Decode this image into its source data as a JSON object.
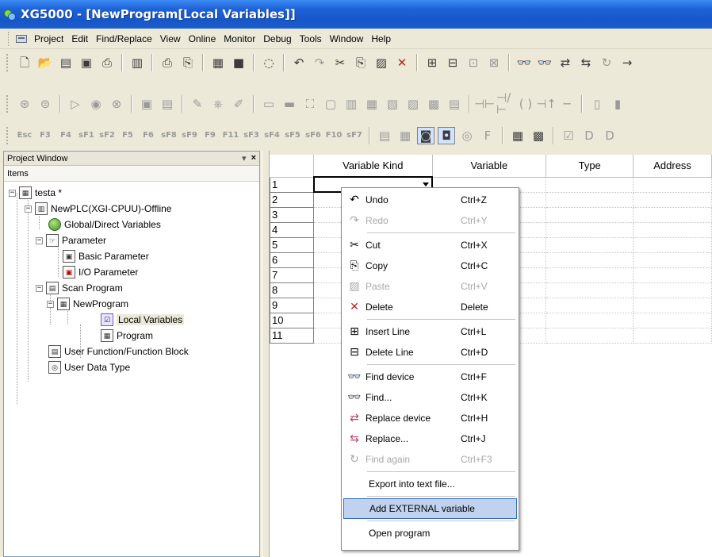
{
  "window": {
    "title": "XG5000 - [NewProgram[Local Variables]]"
  },
  "menubar": {
    "items": [
      "Project",
      "Edit",
      "Find/Replace",
      "View",
      "Online",
      "Monitor",
      "Debug",
      "Tools",
      "Window",
      "Help"
    ]
  },
  "project_window": {
    "title": "Project Window",
    "header": "Items",
    "pin": "▾",
    "close": "×",
    "tree": [
      {
        "label": "testa *",
        "icon": "project-icon"
      },
      {
        "label": "NewPLC(XGI-CPUU)-Offline",
        "icon": "plc-icon"
      },
      {
        "label": "Global/Direct Variables",
        "icon": "globe-icon"
      },
      {
        "label": "Parameter",
        "icon": "parameter-icon"
      },
      {
        "label": "Basic Parameter",
        "icon": "basic-parameter-icon"
      },
      {
        "label": "I/O Parameter",
        "icon": "io-parameter-icon"
      },
      {
        "label": "Scan Program",
        "icon": "scan-program-icon"
      },
      {
        "label": "NewProgram",
        "icon": "program-icon"
      },
      {
        "label": "Local Variables",
        "icon": "local-variables-icon"
      },
      {
        "label": "Program",
        "icon": "program-sheet-icon"
      },
      {
        "label": "User Function/Function Block",
        "icon": "function-block-icon"
      },
      {
        "label": "User Data Type",
        "icon": "data-type-icon"
      }
    ]
  },
  "grid": {
    "columns": [
      "Variable Kind",
      "Variable",
      "Type",
      "Address"
    ],
    "rows": [
      "1",
      "2",
      "3",
      "4",
      "5",
      "6",
      "7",
      "8",
      "9",
      "10",
      "11"
    ]
  },
  "context_menu": {
    "items": [
      {
        "label": "Undo",
        "shortcut": "Ctrl+Z",
        "icon": "undo-icon",
        "enabled": true
      },
      {
        "label": "Redo",
        "shortcut": "Ctrl+Y",
        "icon": "redo-icon",
        "enabled": false
      },
      {
        "label": "Cut",
        "shortcut": "Ctrl+X",
        "icon": "cut-icon",
        "enabled": true
      },
      {
        "label": "Copy",
        "shortcut": "Ctrl+C",
        "icon": "copy-icon",
        "enabled": true
      },
      {
        "label": "Paste",
        "shortcut": "Ctrl+V",
        "icon": "paste-icon",
        "enabled": false
      },
      {
        "label": "Delete",
        "shortcut": "Delete",
        "icon": "delete-icon",
        "enabled": true
      },
      {
        "label": "Insert Line",
        "shortcut": "Ctrl+L",
        "icon": "insert-line-icon",
        "enabled": true
      },
      {
        "label": "Delete Line",
        "shortcut": "Ctrl+D",
        "icon": "delete-line-icon",
        "enabled": true
      },
      {
        "label": "Find device",
        "shortcut": "Ctrl+F",
        "icon": "find-device-icon",
        "enabled": true
      },
      {
        "label": "Find...",
        "shortcut": "Ctrl+K",
        "icon": "find-icon",
        "enabled": true
      },
      {
        "label": "Replace device",
        "shortcut": "Ctrl+H",
        "icon": "replace-device-icon",
        "enabled": true
      },
      {
        "label": "Replace...",
        "shortcut": "Ctrl+J",
        "icon": "replace-icon",
        "enabled": true
      },
      {
        "label": "Find again",
        "shortcut": "Ctrl+F3",
        "icon": "find-again-icon",
        "enabled": false
      },
      {
        "label": "Export into text file...",
        "shortcut": "",
        "icon": "",
        "enabled": true
      },
      {
        "label": "Add EXTERNAL variable",
        "shortcut": "",
        "icon": "",
        "enabled": true,
        "highlighted": true
      },
      {
        "label": "Open program",
        "shortcut": "",
        "icon": "",
        "enabled": true
      }
    ]
  },
  "toolbar3": {
    "labels": [
      "Esc",
      "F3",
      "F4",
      "sF1",
      "sF2",
      "F5",
      "F6",
      "sF8",
      "sF9",
      "F9",
      "F11",
      "sF3",
      "sF4",
      "sF5",
      "sF6",
      "F10",
      "sF7"
    ]
  },
  "colors": {
    "title_bar": "#1f63d8",
    "highlight": "#c1d2ee",
    "highlight_border": "#316ac5"
  }
}
